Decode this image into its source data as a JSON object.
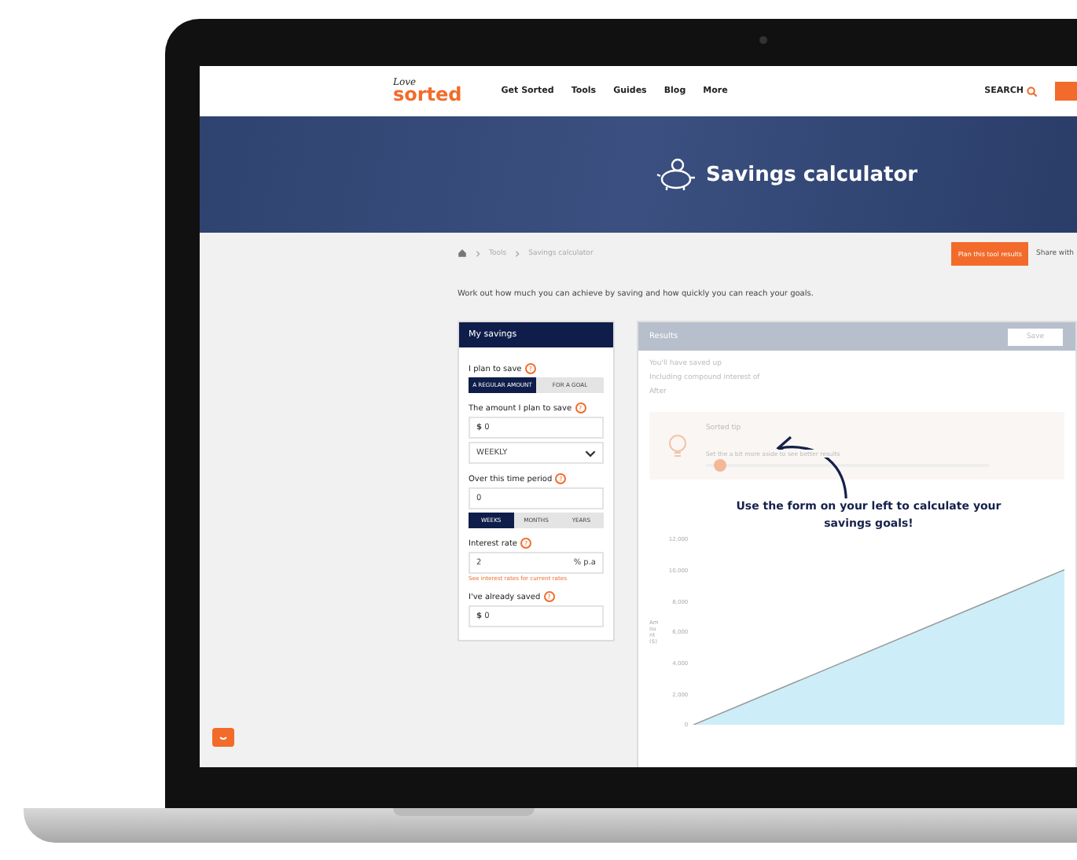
{
  "nav": {
    "logo_top": "Love",
    "logo_main": "sorted",
    "items": [
      "Get Sorted",
      "Tools",
      "Guides",
      "Blog",
      "More"
    ],
    "search": "SEARCH"
  },
  "hero": {
    "title": "Savings calculator"
  },
  "breadcrumb": [
    "Tools",
    "Savings calculator"
  ],
  "actions": {
    "primary": "Plan this tool results",
    "share": "Share with"
  },
  "intro": "Work out how much you can achieve by saving and how quickly you can reach your goals.",
  "form": {
    "title": "My savings",
    "plan_label": "I plan to save",
    "plan_help": "?",
    "plan_options": [
      {
        "label": "A REGULAR AMOUNT",
        "selected": true
      },
      {
        "label": "FOR A GOAL",
        "selected": false
      }
    ],
    "amount_label": "The amount I plan to save",
    "amount_help": "?",
    "amount_prefix": "$",
    "amount_value": "0",
    "frequency": "WEEKLY",
    "period_label": "Over this time period",
    "period_help": "?",
    "period_value": "0",
    "period_units": [
      {
        "label": "WEEKS",
        "selected": true
      },
      {
        "label": "MONTHS",
        "selected": false
      },
      {
        "label": "YEARS",
        "selected": false
      }
    ],
    "interest_label": "Interest rate",
    "interest_help": "?",
    "interest_value": "2",
    "interest_suffix": "% p.a",
    "interest_note": "See interest rates for current rates",
    "saved_label": "I've already saved",
    "saved_help": "?",
    "saved_prefix": "$",
    "saved_value": "0"
  },
  "results": {
    "title": "Results",
    "button": "Save",
    "lines": [
      "You'll have saved up",
      "Including compound interest of",
      "After"
    ],
    "tip_title": "Sorted tip",
    "tip_text": "Set the a bit more aside to see better results",
    "tip_slider": {
      "level": 0.05
    },
    "callout": "Use the form on your left to calculate your savings goals!",
    "chart_data": {
      "type": "area",
      "ylabel": "Amount ($)",
      "ylim": [
        0,
        12000
      ],
      "yticks": [
        {
          "value": 0,
          "label": "0"
        },
        {
          "value": 2000,
          "label": "2,000"
        },
        {
          "value": 4000,
          "label": "4,000"
        },
        {
          "value": 6000,
          "label": "6,000"
        },
        {
          "value": 8000,
          "label": "8,000"
        },
        {
          "value": 10000,
          "label": "10,000"
        },
        {
          "value": 12000,
          "label": "12,000"
        }
      ],
      "series": [
        {
          "color": "#cdeef8",
          "values": [
            0,
            10200
          ]
        }
      ]
    }
  }
}
